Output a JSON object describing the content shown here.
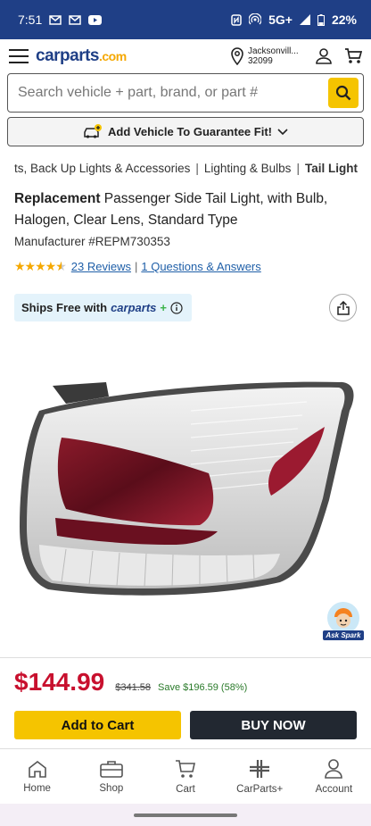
{
  "status_bar": {
    "time": "7:51",
    "network": "5G+",
    "battery": "22%"
  },
  "header": {
    "logo_main": "carparts",
    "logo_suffix": ".com",
    "location_city": "Jacksonvill...",
    "location_zip": "32099"
  },
  "search": {
    "placeholder": "Search vehicle + part, brand, or part #"
  },
  "add_vehicle": {
    "label": "Add Vehicle To Guarantee Fit!"
  },
  "breadcrumb": {
    "items": [
      "ts, Back Up Lights & Accessories",
      "Lighting & Bulbs",
      "Tail Light"
    ]
  },
  "product": {
    "brand": "Replacement",
    "title": "Passenger Side Tail Light, with Bulb, Halogen, Clear Lens, Standard Type",
    "manufacturer": "Manufacturer #REPM730353",
    "rating": 4.5,
    "reviews_link": "23 Reviews",
    "qa_link": "1 Questions & Answers"
  },
  "shipping": {
    "prefix": "Ships Free with",
    "brand": "carparts",
    "plus": "+"
  },
  "spark": {
    "label": "Ask Spark"
  },
  "pricing": {
    "price": "$144.99",
    "was": "$341.58",
    "save": "Save $196.59 (58%)"
  },
  "actions": {
    "add_to_cart": "Add to Cart",
    "buy_now": "BUY NOW"
  },
  "bottom_nav": {
    "home": "Home",
    "shop": "Shop",
    "cart": "Cart",
    "carparts_plus": "CarParts+",
    "account": "Account"
  },
  "colors": {
    "brand_blue": "#1f3f86",
    "accent_yellow": "#f5c400",
    "price_red": "#c8102e",
    "save_green": "#2a7a2a"
  }
}
